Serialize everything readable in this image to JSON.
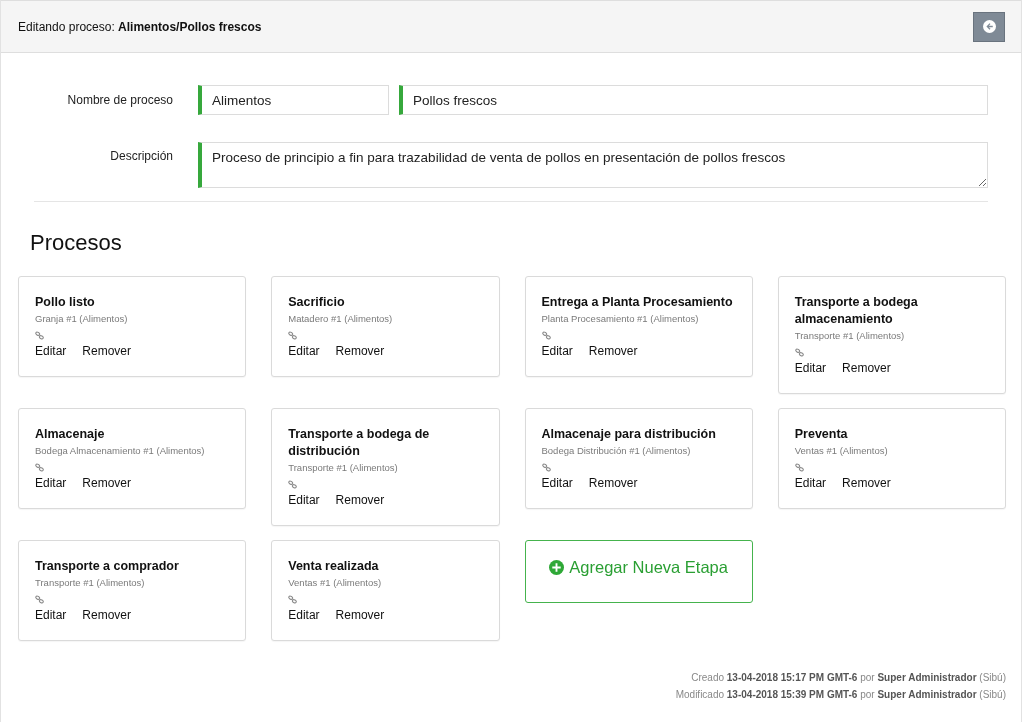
{
  "header": {
    "title": "Editando proceso: **Alimentos/Pollos frescos**"
  },
  "form": {
    "name_label": "Nombre de proceso",
    "name_fields": [
      {
        "value": "Alimentos"
      },
      {
        "value": "Pollos frescos"
      }
    ],
    "description_label": "Descripción",
    "description": "Proceso de principio a fin para trazabilidad de venta de pollos en presentación de pollos frescos"
  },
  "processes": {
    "heading": "Procesos",
    "stages": [
      {
        "title": "Pollo listo",
        "location": "Granja #1 (Alimentos)",
        "actions": [
          "Editar",
          "Remover"
        ]
      },
      {
        "title": "Sacrificio",
        "location": "Matadero #1 (Alimentos)",
        "actions": [
          "Editar",
          "Remover"
        ]
      },
      {
        "title": "Entrega a Planta Procesamiento",
        "location": "Planta Procesamiento #1 (Alimentos)",
        "actions": [
          "Editar",
          "Remover"
        ]
      },
      {
        "title": "Transporte a bodega almacenamiento",
        "location": "Transporte #1 (Alimentos)",
        "actions": [
          "Editar",
          "Remover"
        ]
      },
      {
        "title": "Almacenaje",
        "location": "Bodega Almacenamiento #1 (Alimentos)",
        "actions": [
          "Editar",
          "Remover"
        ]
      },
      {
        "title": "Transporte a bodega de distribución",
        "location": "Transporte #1 (Alimentos)",
        "actions": [
          "Editar",
          "Remover"
        ]
      },
      {
        "title": "Almacenaje para distribución",
        "location": "Bodega Distribución #1 (Alimentos)",
        "actions": [
          "Editar",
          "Remover"
        ]
      },
      {
        "title": "Preventa",
        "location": "Ventas #1 (Alimentos)",
        "actions": [
          "Editar",
          "Remover"
        ]
      },
      {
        "title": "Transporte a comprador",
        "location": "Transporte #1 (Alimentos)",
        "actions": [
          "Editar",
          "Remover"
        ]
      },
      {
        "title": "Venta realizada",
        "location": "Ventas #1 (Alimentos)",
        "actions": [
          "Editar",
          "Remover"
        ]
      }
    ],
    "add_button": {
      "label": "Agregar Nueva Etapa"
    }
  },
  "footer": {
    "lines": [
      "Creado **13-04-2018 15:17 PM GMT-6** por **Super Administrador** (Sibú)",
      "Modificado **13-04-2018 15:39 PM GMT-6** por **Super Administrador** (Sibú)"
    ]
  }
}
